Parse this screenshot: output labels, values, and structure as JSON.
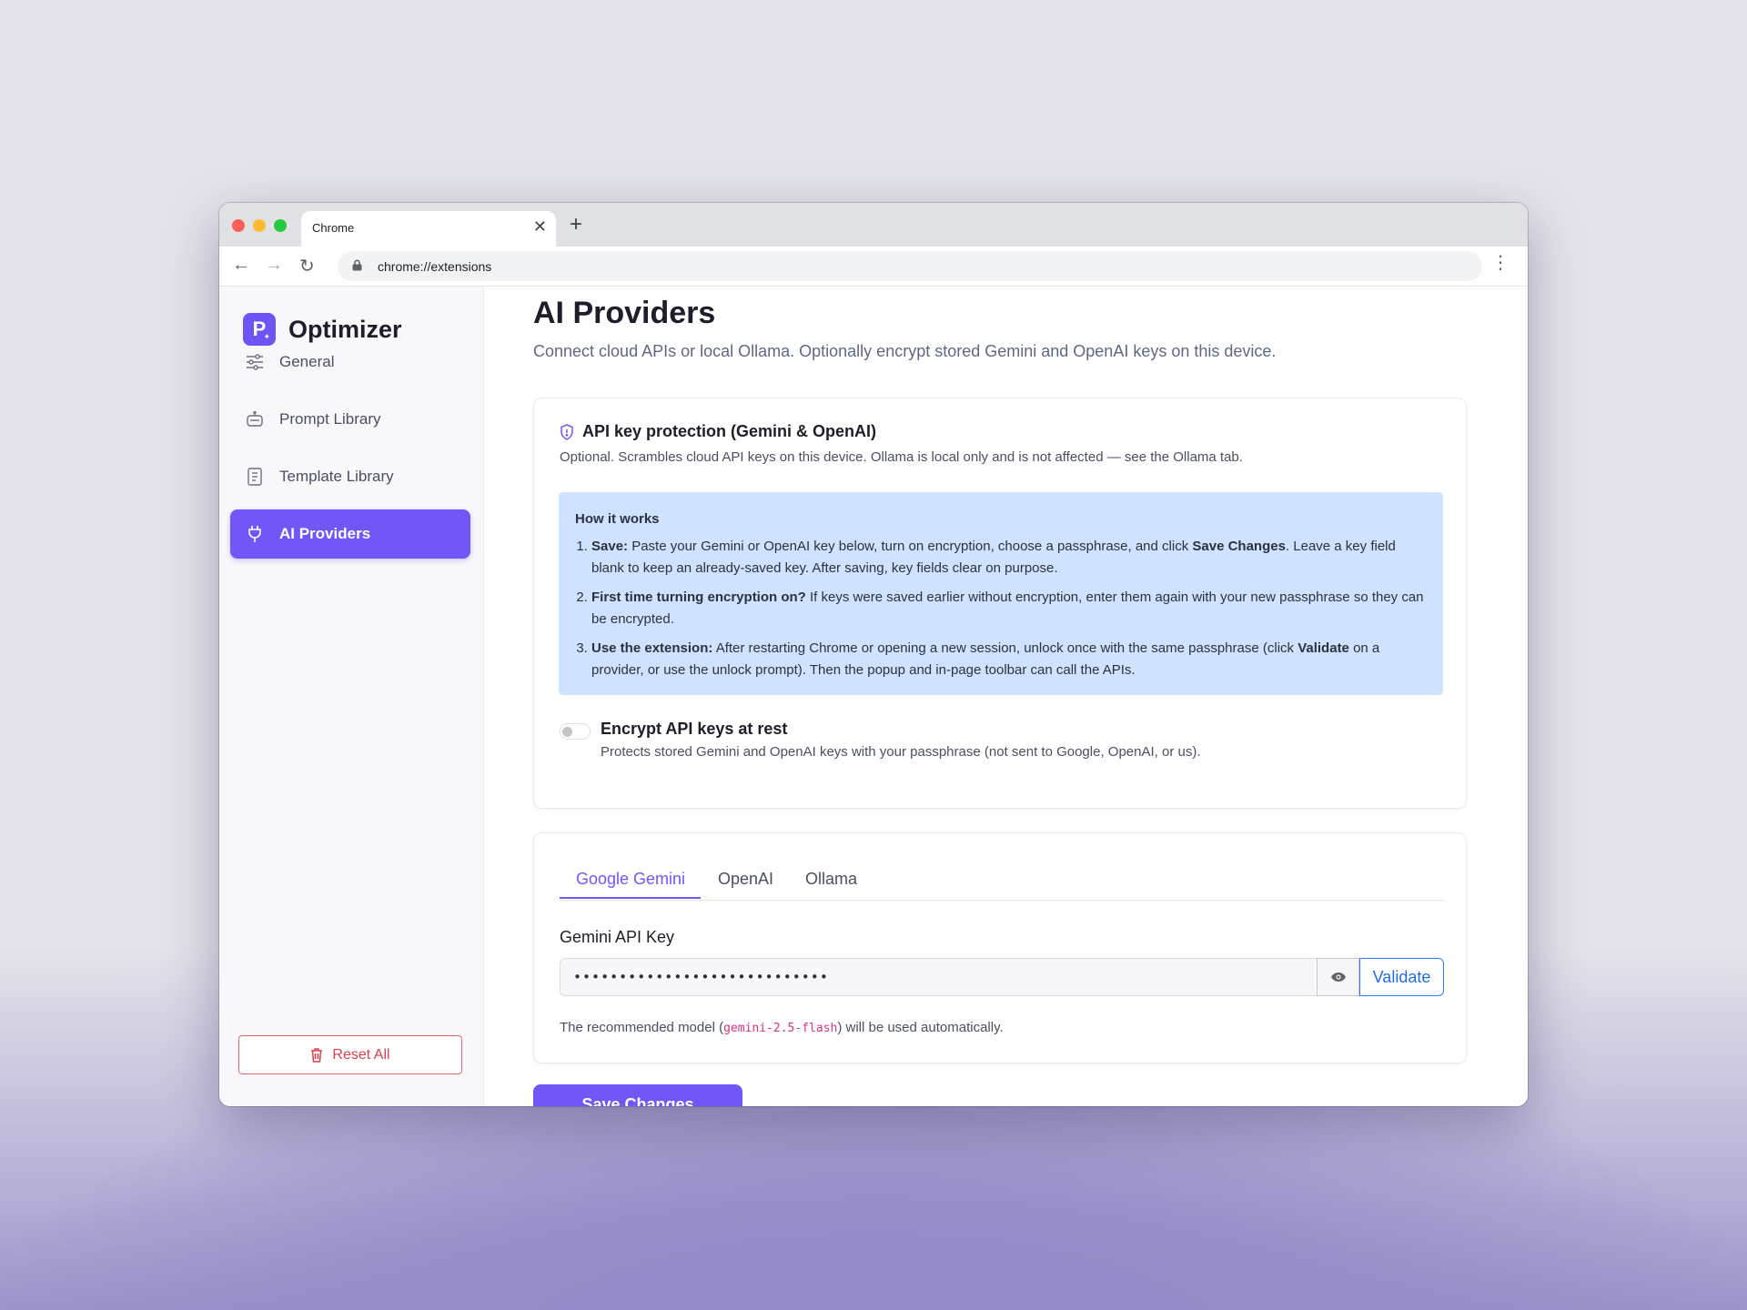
{
  "browser": {
    "tab_title": "Chrome",
    "tab_close": "✕",
    "new_tab": "+",
    "url": "chrome://extensions",
    "back": "←",
    "forward": "→",
    "reload": "↻",
    "menu": "⋮"
  },
  "sidebar": {
    "brand": "Optimizer",
    "brand_logo_letter": "P",
    "items": [
      {
        "label": "General",
        "icon": "sliders-icon"
      },
      {
        "label": "Prompt Library",
        "icon": "robot-icon"
      },
      {
        "label": "Template Library",
        "icon": "document-icon"
      },
      {
        "label": "AI Providers",
        "icon": "plug-icon",
        "active": true
      }
    ],
    "reset_label": "Reset All"
  },
  "main": {
    "title": "AI Providers",
    "subtitle": "Connect cloud APIs or local Ollama. Optionally encrypt stored Gemini and OpenAI keys on this device.",
    "protection": {
      "title": "API key protection (Gemini & OpenAI)",
      "description": "Optional. Scrambles cloud API keys on this device. Ollama is local only and is not affected — see the Ollama tab.",
      "how_title": "How it works",
      "steps": [
        {
          "bold": "Save:",
          "text": " Paste your Gemini or OpenAI key below, turn on encryption, choose a passphrase, and click ",
          "bold2": "Save Changes",
          "text2": ". Leave a key field blank to keep an already-saved key. After saving, key fields clear on purpose."
        },
        {
          "bold": "First time turning encryption on?",
          "text": " If keys were saved earlier without encryption, enter them again with your new passphrase so they can be encrypted.",
          "bold2": "",
          "text2": ""
        },
        {
          "bold": "Use the extension:",
          "text": " After restarting Chrome or opening a new session, unlock once with the same passphrase (click ",
          "bold2": "Validate",
          "text2": " on a provider, or use the unlock prompt). Then the popup and in-page toolbar can call the APIs."
        }
      ],
      "toggle_label": "Encrypt API keys at rest",
      "toggle_on": false,
      "toggle_help": "Protects stored Gemini and OpenAI keys with your passphrase (not sent to Google, OpenAI, or us)."
    },
    "providers": {
      "tabs": [
        "Google Gemini",
        "OpenAI",
        "Ollama"
      ],
      "active_tab": "Google Gemini",
      "key_label": "Gemini API Key",
      "key_value": "••••••••••••••••••••••••••••",
      "validate_label": "Validate",
      "model_note_prefix": "The recommended model (",
      "model_name": "gemini-2.5-flash",
      "model_note_suffix": ") will be used automatically."
    },
    "save_label": "Save Changes"
  },
  "colors": {
    "accent": "#7356f6",
    "danger": "#d9404d",
    "info_bg": "#cfe2ff",
    "link_blue": "#1f6fe8"
  }
}
